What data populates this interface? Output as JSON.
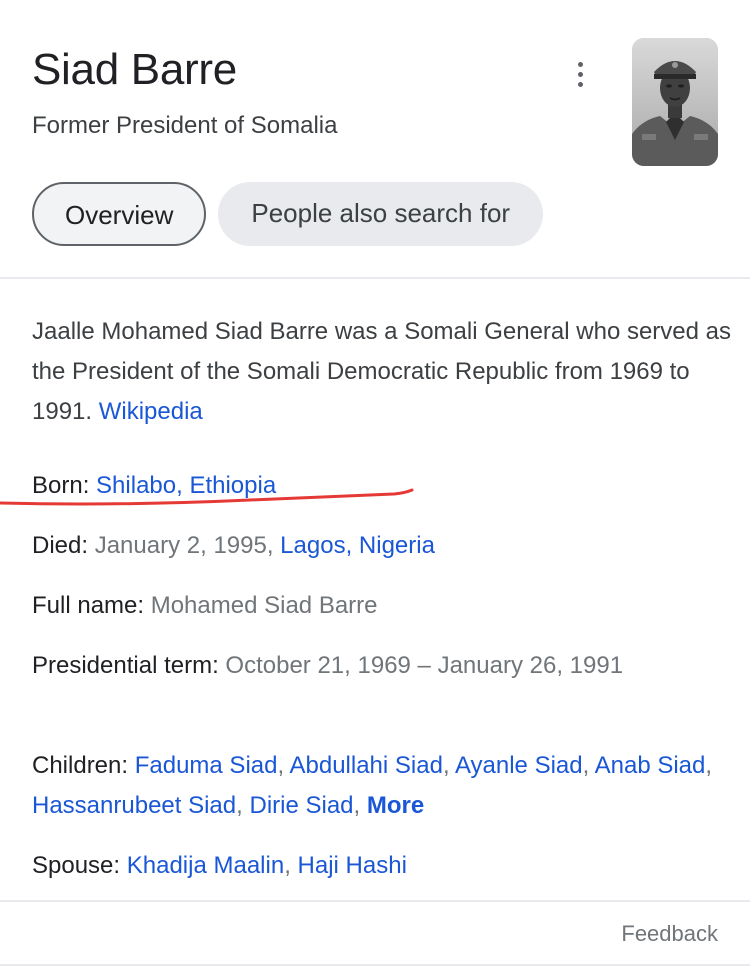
{
  "header": {
    "title": "Siad Barre",
    "subtitle": "Former President of Somalia"
  },
  "icons": {
    "menu": "more-vert-icon",
    "portrait": "portrait-image"
  },
  "tabs": [
    {
      "label": "Overview",
      "active": true
    },
    {
      "label": "People also search for",
      "active": false
    }
  ],
  "description": {
    "text": "Jaalle Mohamed Siad Barre was a Somali General who served as the President of the Somali Democratic Republic from 1969 to 1991.",
    "source": "Wikipedia"
  },
  "facts": {
    "born": {
      "label": "Born:",
      "place": "Shilabo, Ethiopia"
    },
    "died": {
      "label": "Died:",
      "date": "January 2, 1995,",
      "place": "Lagos, Nigeria"
    },
    "full_name": {
      "label": "Full name:",
      "value": "Mohamed Siad Barre"
    },
    "term": {
      "label": "Presidential term:",
      "value": "October 21, 1969 – January 26, 1991"
    },
    "children": {
      "label": "Children:",
      "names": [
        "Faduma Siad",
        "Abdullahi Siad",
        "Ayanle Siad",
        "Anab Siad",
        "Hassanrubeet Siad",
        "Dirie Siad"
      ],
      "more": "More"
    },
    "spouse": {
      "label": "Spouse:",
      "names": [
        "Khadija Maalin",
        "Haji Hashi"
      ]
    }
  },
  "footer": {
    "feedback": "Feedback"
  },
  "colors": {
    "link": "#1a57d6",
    "annotation": "#e53935",
    "muted": "#70757a"
  }
}
